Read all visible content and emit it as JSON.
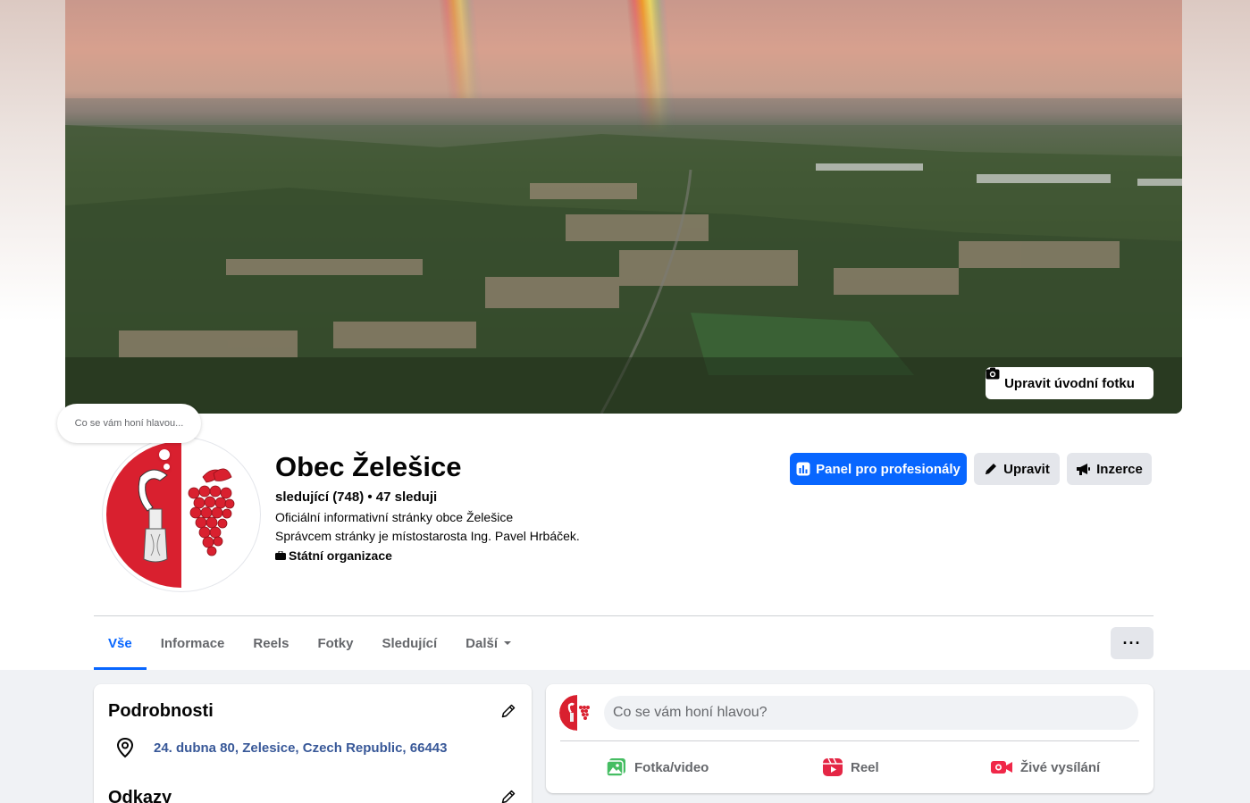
{
  "cover": {
    "edit_label": "Upravit úvodní fotku"
  },
  "thought_bubble": "Co se vám honí hlavou...",
  "profile": {
    "name": "Obec Želešice",
    "followers": "sledující (748) • 47 sleduji",
    "description_line1": "Oficiální informativní stránky obce Želešice",
    "description_line2": "Správcem stránky je místostarosta Ing. Pavel Hrbáček.",
    "category": "Státní organizace"
  },
  "actions": {
    "professional_dashboard": "Panel pro profesionály",
    "edit": "Upravit",
    "ads": "Inzerce"
  },
  "tabs": [
    {
      "label": "Vše",
      "active": true
    },
    {
      "label": "Informace"
    },
    {
      "label": "Reels"
    },
    {
      "label": "Fotky"
    },
    {
      "label": "Sledující"
    },
    {
      "label": "Další"
    }
  ],
  "more_button": "···",
  "details": {
    "title": "Podrobnosti",
    "address": "24. dubna 80, Zelesice, Czech Republic, 66443",
    "links_title": "Odkazy"
  },
  "composer": {
    "placeholder": "Co se vám honí hlavou?",
    "photo_video": "Fotka/video",
    "reel": "Reel",
    "live": "Živé vysílání"
  },
  "colors": {
    "accent": "#0866ff",
    "link": "#385898",
    "coat_red": "#d9202f"
  }
}
